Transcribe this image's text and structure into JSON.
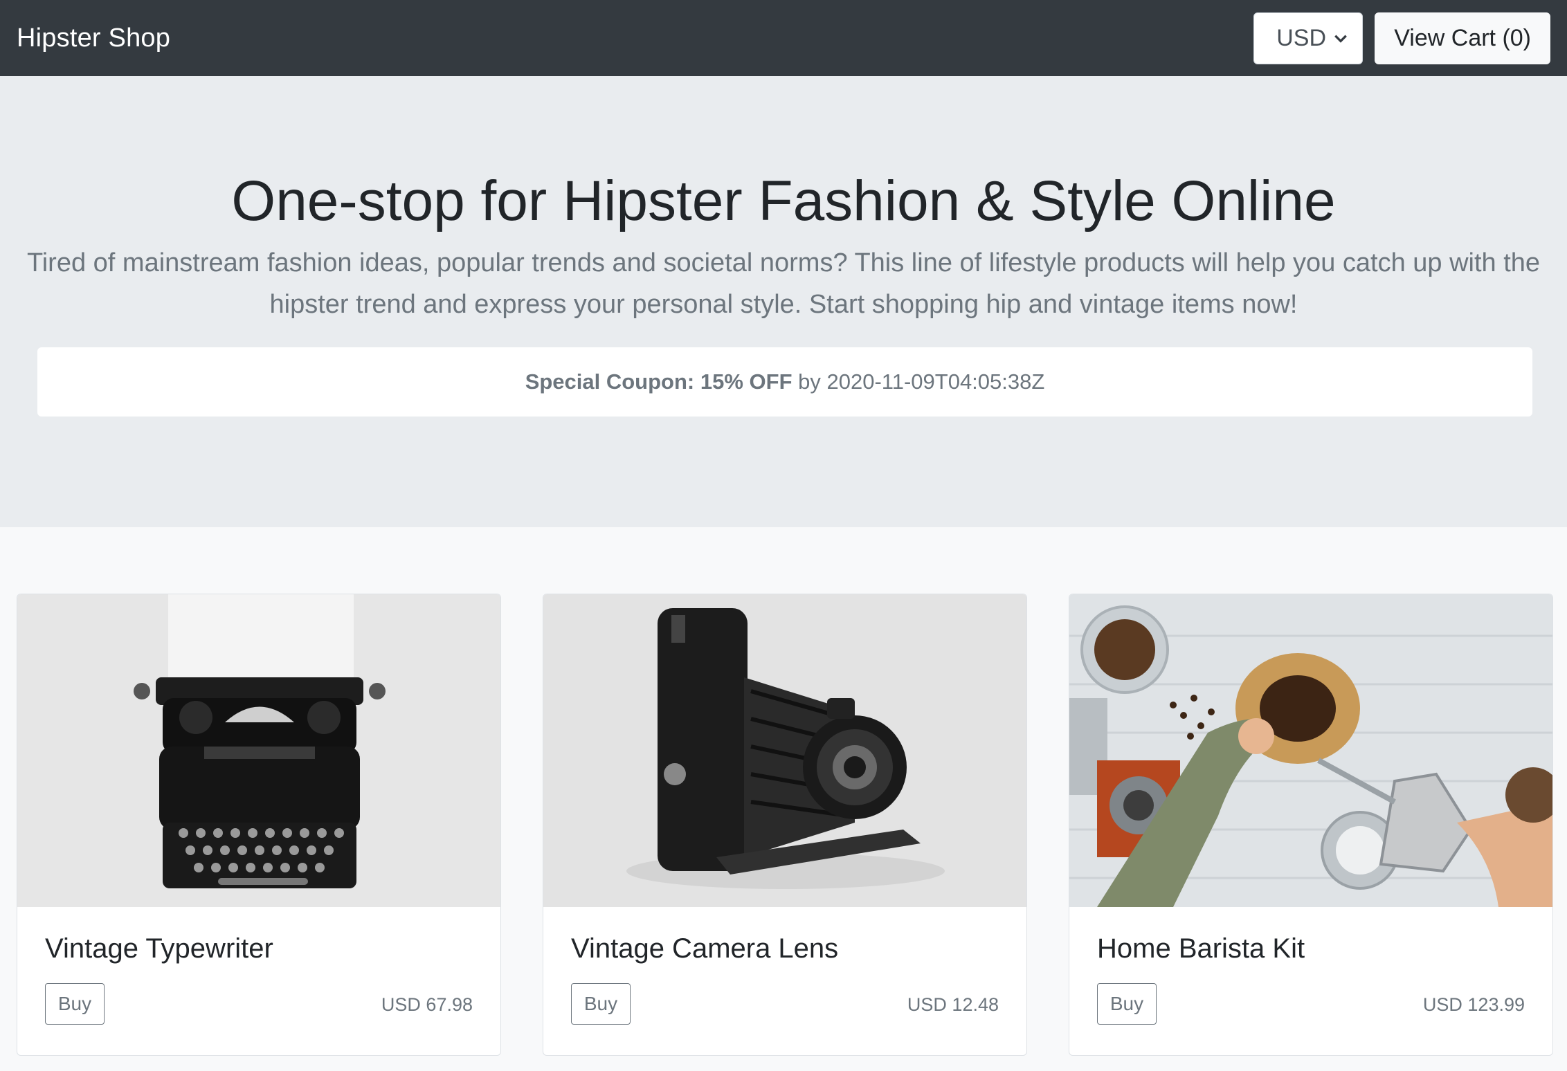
{
  "navbar": {
    "brand": "Hipster Shop",
    "currency": {
      "selected": "USD"
    },
    "cart_label": "View Cart (0)"
  },
  "hero": {
    "title": "One-stop for Hipster Fashion & Style Online",
    "lead": "Tired of mainstream fashion ideas, popular trends and societal norms? This line of lifestyle products will help you catch up with the hipster trend and express your personal style. Start shopping hip and vintage items now!",
    "coupon": {
      "label": "Special Coupon: 15% OFF",
      "by_text": "by 2020-11-09T04:05:38Z"
    }
  },
  "products": [
    {
      "name": "Vintage Typewriter",
      "buy_label": "Buy",
      "price": "USD 67.98"
    },
    {
      "name": "Vintage Camera Lens",
      "buy_label": "Buy",
      "price": "USD 12.48"
    },
    {
      "name": "Home Barista Kit",
      "buy_label": "Buy",
      "price": "USD 123.99"
    }
  ]
}
